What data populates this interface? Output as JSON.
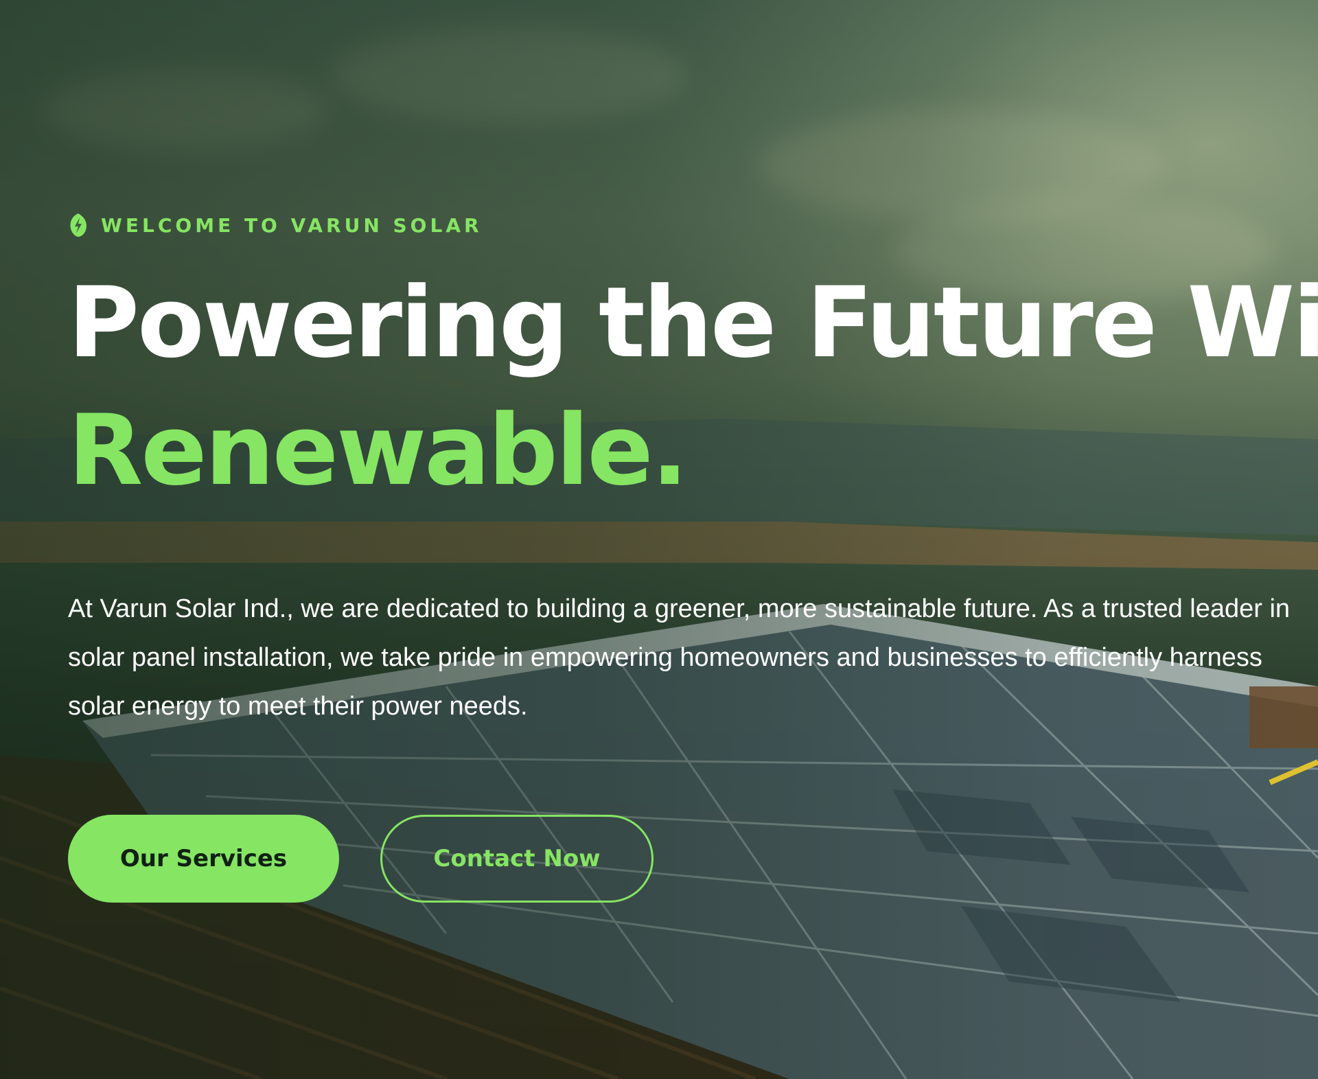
{
  "hero": {
    "eyebrow": "WELCOME TO VARUN SOLAR",
    "headline_line1": "Powering the Future With",
    "headline_accent": "Renewable.",
    "intro": "At Varun Solar Ind., we are dedicated to building a greener, more sustainable future. As a trusted leader in solar panel installation, we take pride in empowering homeowners and businesses to efficiently harness solar energy to meet their power needs.",
    "icon": "leaf-bolt-icon"
  },
  "actions": {
    "services_label": "Our Services",
    "contact_label": "Contact Now"
  },
  "colors": {
    "accent": "#86e563",
    "text": "#ffffff",
    "button_text": "#102114"
  }
}
